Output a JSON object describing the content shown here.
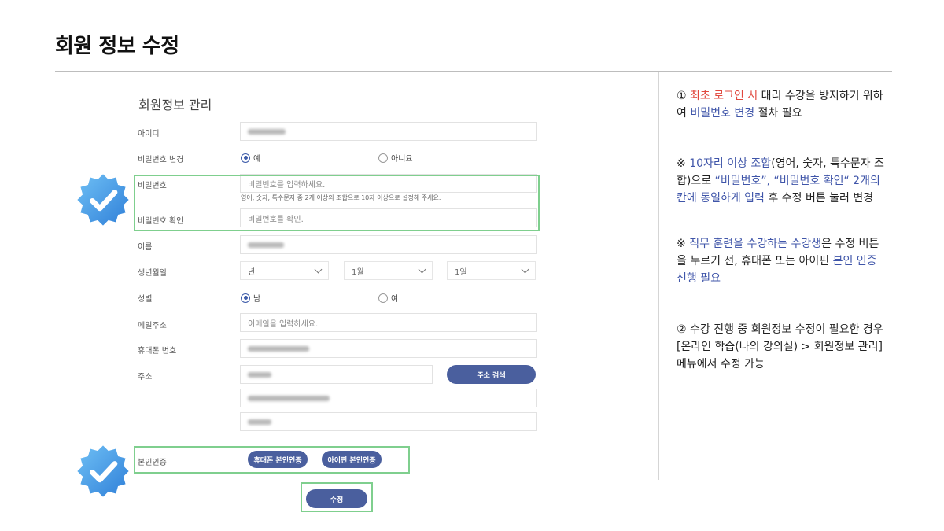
{
  "page": {
    "title": "회원 정보 수정"
  },
  "form": {
    "heading": "회원정보 관리",
    "id_label": "아이디",
    "pw_change_label": "비밀번호 변경",
    "pw_change_options": [
      "예",
      "아니요"
    ],
    "pw_change_selected": "예",
    "pw_label": "비밀번호",
    "pw_placeholder": "비밀번호를 입력하세요.",
    "pw_help": "영어, 숫자, 특수문자 중 2개 이상의 조합으로 10자 이상으로 설정해 주세요.",
    "pw_confirm_label": "비밀번호 확인",
    "pw_confirm_placeholder": "비밀번호를 확인.",
    "name_label": "이름",
    "birth_label": "생년월일",
    "birth_year": "년",
    "birth_month": "1월",
    "birth_day": "1일",
    "gender_label": "성별",
    "gender_options": [
      "남",
      "여"
    ],
    "gender_selected": "남",
    "email_label": "메일주소",
    "email_placeholder": "이메일을 입력하세요.",
    "phone_label": "휴대폰 번호",
    "address_label": "주소",
    "address_search_button": "주소 검색",
    "verify_label": "본인인증",
    "verify_phone_button": "휴대폰 본인인증",
    "verify_ipin_button": "아이핀 본인인증",
    "submit_button": "수정"
  },
  "notes": {
    "note1": {
      "prefix": "① ",
      "red": "최초 로그인 시",
      "mid": " 대리 수강을 방지하기 위하여 ",
      "blue": "비밀번호 변경",
      "suffix": " 절차 필요"
    },
    "note2": {
      "prefix": "※ ",
      "blue1": "10자리 이상 조합",
      "mid1": "(영어, 숫자, 특수문자 조합)으로 ",
      "blue2": "“비밀번호”, “비밀번호 확인“ 2개의 칸에 동일하게 입력",
      "suffix": " 후 수정 버튼 눌러 변경"
    },
    "note3": {
      "prefix": "※ ",
      "blue1": "직무 훈련을 수강하는 수강생",
      "mid": "은 수정 버튼을 누르기 전, 휴대폰 또는 아이핀 ",
      "blue2": "본인 인증 선행 필요"
    },
    "note4": {
      "text": "② 수강 진행 중 회원정보 수정이 필요한 경우 [온라인 학습(나의 강의실) > 회원정보 관리] 메뉴에서 수정 가능"
    }
  },
  "colors": {
    "accent": "#4a5f9e",
    "highlight": "#7fcf8e",
    "red": "#e1483e",
    "blue": "#3f55a9"
  },
  "icons": {
    "verified_badge": "verified-badge-icon"
  }
}
